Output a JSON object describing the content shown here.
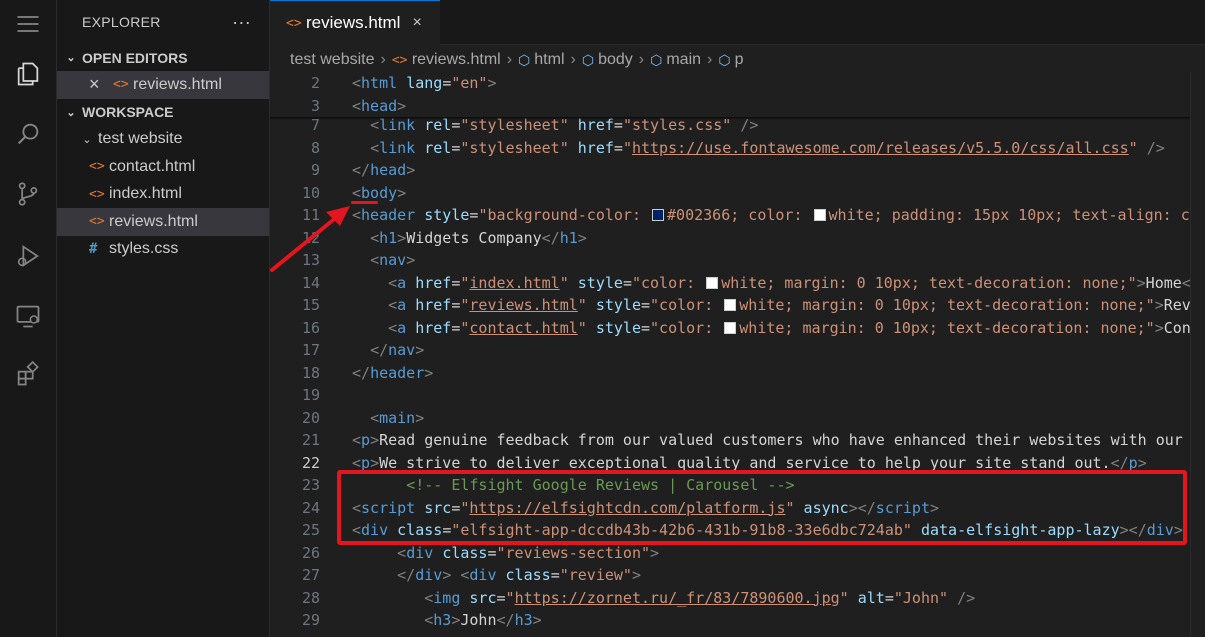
{
  "sidebar": {
    "title": "EXPLORER",
    "more": "···",
    "open_editors_label": "OPEN EDITORS",
    "open_editor_file": "reviews.html",
    "workspace_label": "WORKSPACE",
    "folder": "test website",
    "files": [
      {
        "name": "contact.html",
        "icon": "<>"
      },
      {
        "name": "index.html",
        "icon": "<>"
      },
      {
        "name": "reviews.html",
        "icon": "<>"
      },
      {
        "name": "styles.css",
        "icon": "#"
      }
    ]
  },
  "tab": {
    "label": "reviews.html",
    "close": "×"
  },
  "breadcrumb": [
    "test website",
    "reviews.html",
    "html",
    "body",
    "main",
    "p"
  ],
  "code": {
    "n2": "2",
    "n3": "3",
    "n7": "7",
    "n9": "9",
    "n10": "10",
    "n11": "11",
    "n12": "12",
    "n13": "13",
    "n14": "14",
    "n15": "15",
    "n16": "16",
    "n17": "17",
    "n18": "18",
    "n19": "19",
    "n20": "20",
    "n21": "21",
    "n22": "22",
    "n23": "23",
    "n24": "24",
    "n25": "25",
    "n26": "26",
    "n27": "27",
    "n28": "28",
    "n29": "29",
    "l2_lang": "\"en\"",
    "l7_href": "\"styles.css\"",
    "l8_href": "https://use.fontawesome.com/releases/v5.5.0/css/all.css",
    "l11_style_a": "\"background-color: ",
    "l11_style_b": "#002366; color: ",
    "l11_style_c": "white; padding: 15px 10px; text-align: c",
    "l12_text": "Widgets Company",
    "l14_href": "index.html",
    "l14_style": "white; margin: 0 10px; text-decoration: none;\"",
    "l14_text": "Home",
    "l15_href": "reviews.html",
    "l15_text": "Rev",
    "l16_href": "contact.html",
    "l16_text": "Con",
    "style_color": "\"color: ",
    "l21_text": "Read genuine feedback from our valued customers who have enhanced their websites with our",
    "l22_text": "We strive to deliver exceptional quality and service to help your site stand out.",
    "l23_comment": "<!-- Elfsight Google Reviews | Carousel -->",
    "l24_src": "https://elfsightcdn.com/platform.js",
    "l25_class": "\"elfsight-app-dccdb43b-42b6-431b-91b8-33e6dbc724ab\"",
    "l25_attr": "data-elfsight-app-lazy",
    "l26_class": "\"reviews-section\"",
    "l27_class": "\"review\"",
    "l28_src": "https://zornet.ru/_fr/83/7890600.jpg",
    "l28_alt": "\"John\"",
    "l29_text": "John"
  },
  "colors": {
    "annotation": "#e3151e",
    "swatch_navy": "#002366",
    "swatch_white": "#ffffff"
  }
}
